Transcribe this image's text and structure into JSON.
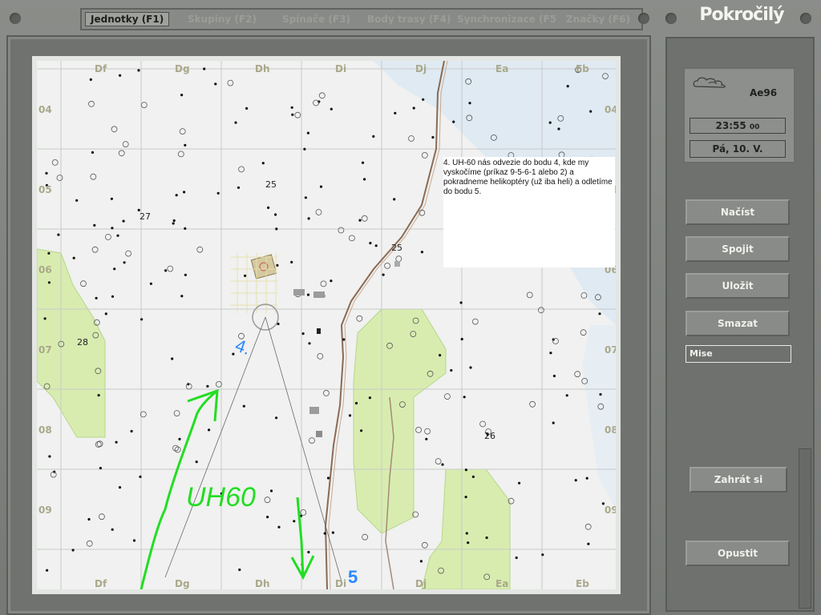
{
  "tabs": [
    {
      "label": "Jednotky  (F1)",
      "active": true
    },
    {
      "label": "Skupiny  (F2)",
      "active": false
    },
    {
      "label": "Spínače  (F3)",
      "active": false
    },
    {
      "label": "Body  trasy  (F4)",
      "active": false
    },
    {
      "label": "Synchronizace  (F5",
      "active": false
    },
    {
      "label": "Značky  (F6)",
      "active": false
    }
  ],
  "difficulty_title": "Pokročilý",
  "player_name": "Ae96",
  "time": "23:55",
  "time_seconds": "00",
  "date": "Pá,  10.  V.",
  "buttons": {
    "load": "Načíst",
    "merge": "Spojit",
    "save": "Uložit",
    "delete": "Smazat",
    "play": "Zahrát  si",
    "quit": "Opustit"
  },
  "mission_label": "Mise",
  "weather_icon": "cloud-icon",
  "map": {
    "col_labels": [
      "Df",
      "Dg",
      "Dh",
      "Di",
      "Dj",
      "Ea",
      "Eb"
    ],
    "row_labels": [
      "04",
      "05",
      "06",
      "07",
      "08",
      "09"
    ],
    "elevations": [
      "25",
      "27",
      "25",
      "28",
      "26"
    ],
    "note": "4. UH-60 nás odvezie do bodu 4, kde my vyskočíme (príkaz 9-5-6-1 alebo 2) a pokradneme helikoptéry (už iba heli) a odletíme do bodu 5.",
    "drawings": {
      "uh60": "UH60",
      "waypoint4": "4.",
      "waypoint5": "5"
    },
    "colors": {
      "forest": "#d8ecb0",
      "water": "#dfeaf2",
      "road": "#8a6a55",
      "drawing_green": "#22dd22",
      "drawing_blue": "#2a88ff"
    }
  }
}
